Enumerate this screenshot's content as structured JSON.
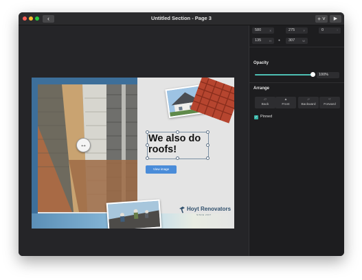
{
  "window": {
    "title": "Untitled Section - Page 3",
    "back_icon": "chevron-left-icon",
    "add_button_label": "+ ˅",
    "play_icon": "play-icon"
  },
  "slide": {
    "headline": "We also do roofs!",
    "button_label": "View image",
    "logo_name": "Hoyt Renovators",
    "logo_tagline": "SINCE 2007",
    "accent_blue": "#3d6f9a",
    "button_blue": "#4a8cd9"
  },
  "inspector": {
    "position": {
      "x": {
        "value": "580",
        "label": "X"
      },
      "y": {
        "value": "275",
        "label": "Y"
      },
      "rotation": {
        "value": "0",
        "label": "°"
      }
    },
    "size": {
      "h": {
        "value": "135",
        "label": "H"
      },
      "w": {
        "value": "307",
        "label": "W"
      },
      "lock_icon": "lock-icon"
    },
    "opacity": {
      "title": "Opacity",
      "value": "100%",
      "level": 1.0,
      "accent": "#4ec0b4"
    },
    "arrange": {
      "title": "Arrange",
      "buttons": [
        {
          "label": "Back",
          "icon": "send-to-back-icon"
        },
        {
          "label": "Front",
          "icon": "bring-to-front-icon"
        },
        {
          "label": "Backward",
          "icon": "send-backward-icon"
        },
        {
          "label": "Forward",
          "icon": "bring-forward-icon"
        }
      ]
    },
    "pinned": {
      "label": "Pinned",
      "checked": true
    }
  }
}
